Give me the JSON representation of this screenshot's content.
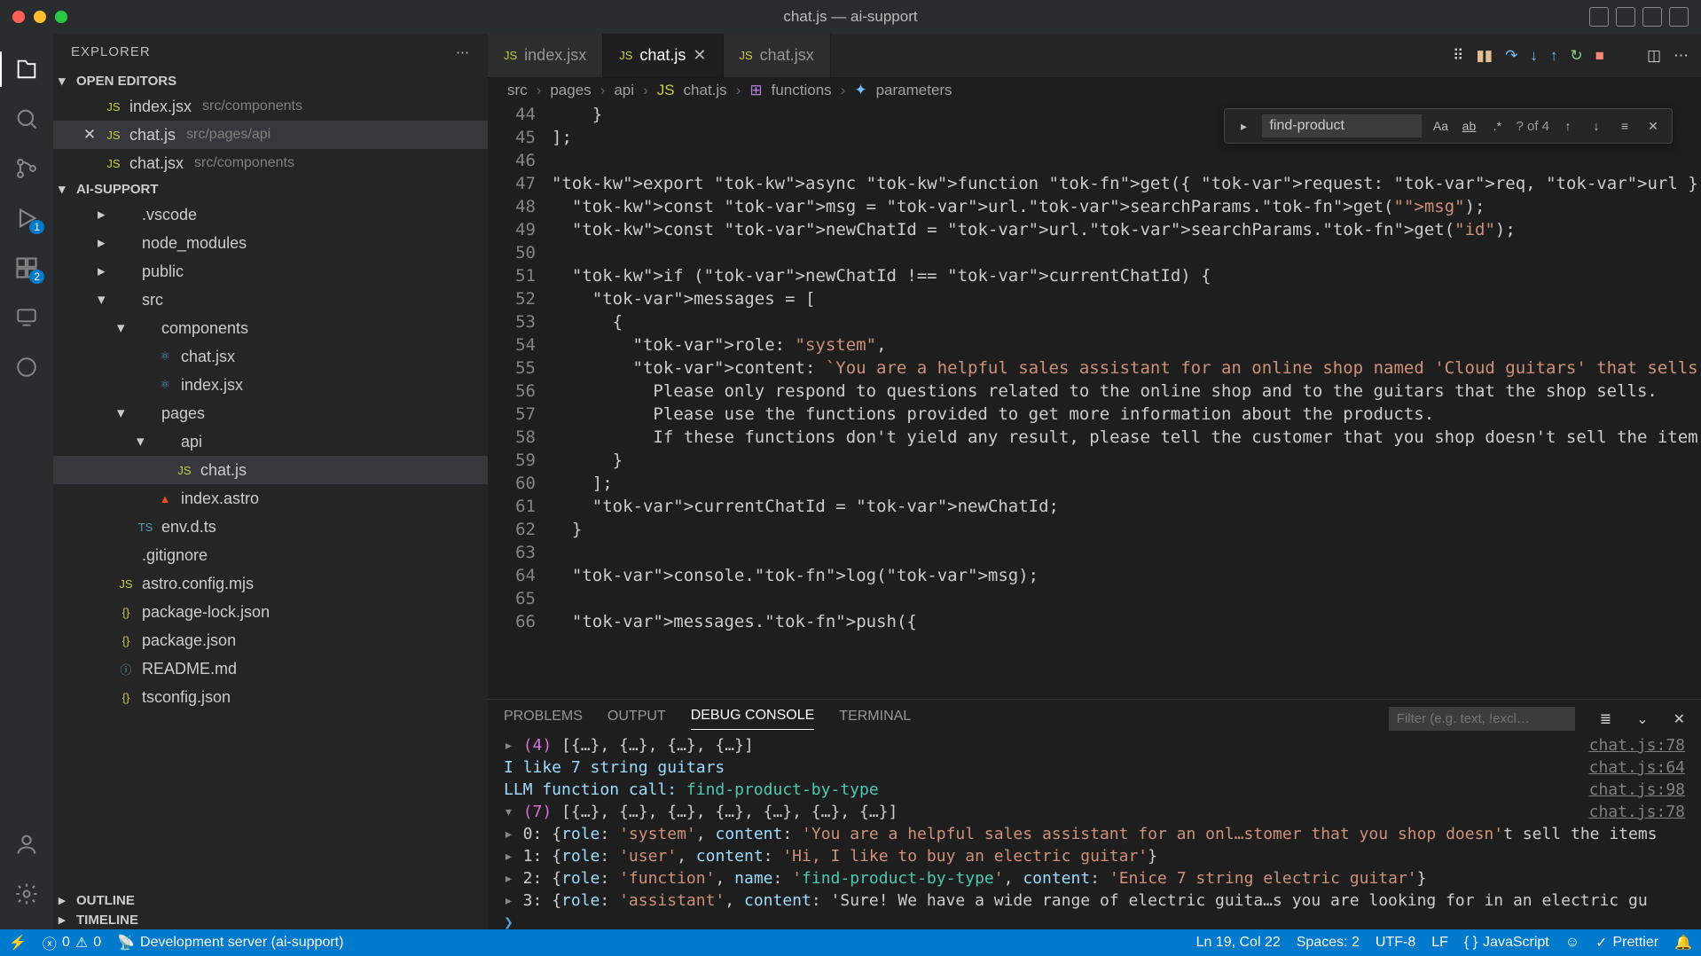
{
  "window": {
    "title": "chat.js — ai-support"
  },
  "explorer": {
    "title": "EXPLORER",
    "open_editors": {
      "label": "OPEN EDITORS",
      "items": [
        {
          "name": "index.jsx",
          "desc": "src/components"
        },
        {
          "name": "chat.js",
          "desc": "src/pages/api",
          "active": true
        },
        {
          "name": "chat.jsx",
          "desc": "src/components"
        }
      ]
    },
    "project": {
      "label": "AI-SUPPORT",
      "tree": [
        {
          "label": ".vscode",
          "depth": 1,
          "chev": true
        },
        {
          "label": "node_modules",
          "depth": 1,
          "chev": true
        },
        {
          "label": "public",
          "depth": 1,
          "chev": true
        },
        {
          "label": "src",
          "depth": 1,
          "chev": true,
          "open": true
        },
        {
          "label": "components",
          "depth": 2,
          "chev": true,
          "open": true
        },
        {
          "label": "chat.jsx",
          "depth": 3,
          "icon": "jsx"
        },
        {
          "label": "index.jsx",
          "depth": 3,
          "icon": "jsx"
        },
        {
          "label": "pages",
          "depth": 2,
          "chev": true,
          "open": true
        },
        {
          "label": "api",
          "depth": 3,
          "chev": true,
          "open": true
        },
        {
          "label": "chat.js",
          "depth": 4,
          "icon": "js",
          "selected": true
        },
        {
          "label": "index.astro",
          "depth": 3,
          "icon": "astro"
        },
        {
          "label": "env.d.ts",
          "depth": 2,
          "icon": "ts"
        },
        {
          "label": ".gitignore",
          "depth": 1,
          "icon": "none"
        },
        {
          "label": "astro.config.mjs",
          "depth": 1,
          "icon": "js"
        },
        {
          "label": "package-lock.json",
          "depth": 1,
          "icon": "json"
        },
        {
          "label": "package.json",
          "depth": 1,
          "icon": "json"
        },
        {
          "label": "README.md",
          "depth": 1,
          "icon": "md"
        },
        {
          "label": "tsconfig.json",
          "depth": 1,
          "icon": "json"
        }
      ]
    },
    "outline_label": "OUTLINE",
    "timeline_label": "TIMELINE"
  },
  "tabs": [
    {
      "label": "index.jsx",
      "icon": "jsx"
    },
    {
      "label": "chat.js",
      "icon": "js",
      "active": true,
      "close": true
    },
    {
      "label": "chat.jsx",
      "icon": "jsx"
    }
  ],
  "breadcrumb": {
    "parts": [
      "src",
      "pages",
      "api",
      "chat.js",
      "functions",
      "parameters"
    ]
  },
  "find": {
    "value": "find-product",
    "count": "? of 4"
  },
  "editor": {
    "first_line": 44,
    "lines": [
      "    }",
      "];",
      "",
      "export async function get({ request: req, url }) {",
      "  const msg = url.searchParams.get(\"msg\");",
      "  const newChatId = url.searchParams.get(\"id\");",
      "",
      "  if (newChatId !== currentChatId) {",
      "    messages = [",
      "      {",
      "        role: \"system\",",
      "        content: `You are a helpful sales assistant for an online shop named 'Cloud guitars' that sells and deliv",
      "          Please only respond to questions related to the online shop and to the guitars that the shop sells.",
      "          Please use the functions provided to get more information about the products.",
      "          If these functions don't yield any result, please tell the customer that you shop doesn't sell the item",
      "      }",
      "    ];",
      "    currentChatId = newChatId;",
      "  }",
      "",
      "  console.log(msg);",
      "",
      "  messages.push({"
    ]
  },
  "panel": {
    "tabs": {
      "problems": "PROBLEMS",
      "output": "OUTPUT",
      "debug": "DEBUG CONSOLE",
      "terminal": "TERMINAL"
    },
    "filter_placeholder": "Filter (e.g. text, !excl…",
    "lines": [
      {
        "left": "▸ (4) [{…}, {…}, {…}, {…}]",
        "src": "chat.js:78"
      },
      {
        "left": "  I like 7 string guitars",
        "src": "chat.js:64"
      },
      {
        "left": "  LLM function call:  find-product-by-type",
        "src": "chat.js:98"
      },
      {
        "left": "▾ (7) [{…}, {…}, {…}, {…}, {…}, {…}, {…}]",
        "src": "chat.js:78"
      },
      {
        "left": "  ▸ 0: {role: 'system', content: 'You are a helpful sales assistant for an onl…stomer that you shop doesn't sell the items",
        "src": ""
      },
      {
        "left": "  ▸ 1: {role: 'user', content: 'Hi, I like to buy an electric guitar'}",
        "src": ""
      },
      {
        "left": "  ▸ 2: {role: 'function', name: 'find-product-by-type', content: 'Enice 7 string electric guitar'}",
        "src": ""
      },
      {
        "left": "  ▸ 3: {role: 'assistant', content: 'Sure! We have a wide range of electric guita…s you are looking for in an electric gu",
        "src": ""
      }
    ],
    "prompt": "❯"
  },
  "statusbar": {
    "errors": "0",
    "warnings": "0",
    "dev": "Development server (ai-support)",
    "cursor": "Ln 19, Col 22",
    "spaces": "Spaces: 2",
    "encoding": "UTF-8",
    "eol": "LF",
    "lang": "JavaScript",
    "prettier": "Prettier"
  },
  "activity_badges": {
    "debug": "1",
    "ext": "2"
  }
}
